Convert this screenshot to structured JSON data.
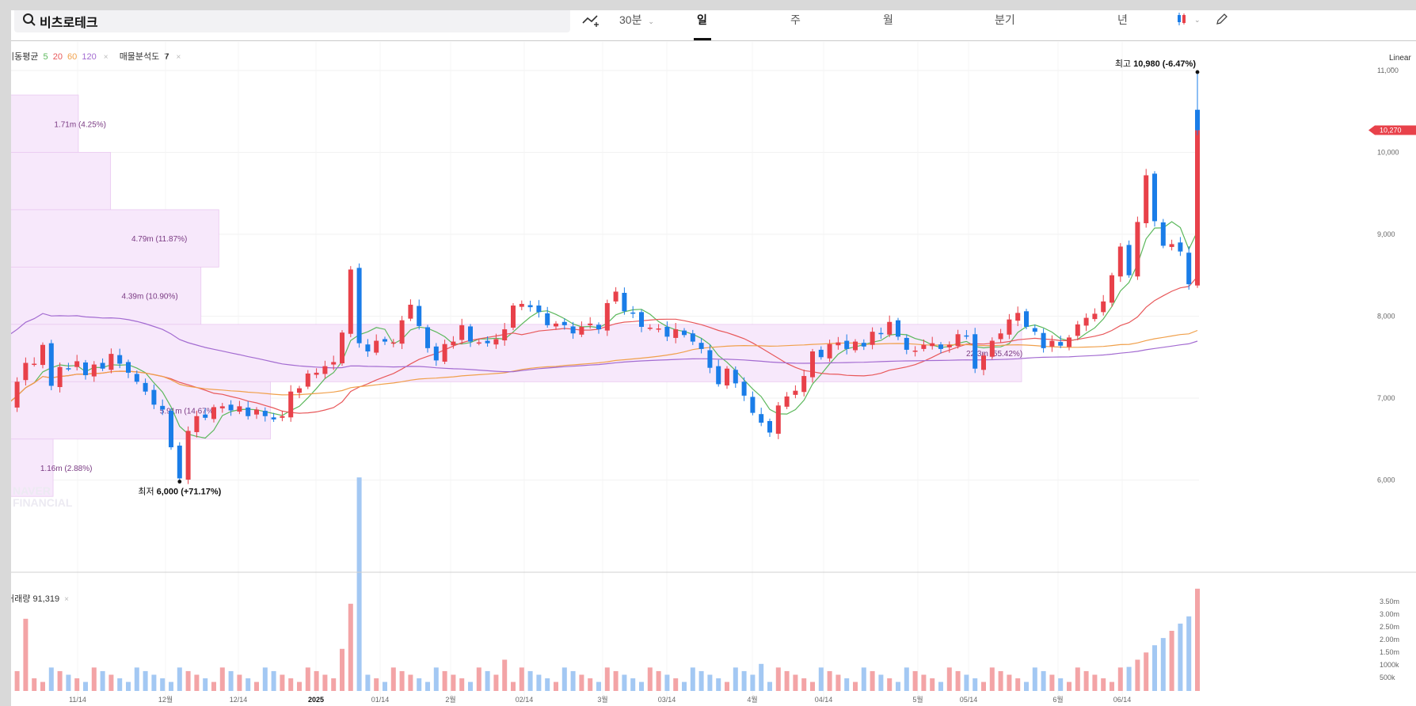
{
  "search": {
    "value": "비츠로테크"
  },
  "toolbar": {
    "drawing_icon": "trend-line-icon",
    "interval": "30분",
    "tabs": [
      "일",
      "주",
      "월",
      "분기",
      "년"
    ],
    "active_tab": "일",
    "chart_style_icon": "candle-icon",
    "edit_icon": "pencil-icon"
  },
  "overlays": {
    "ma_label": "이동평균",
    "ma_periods": [
      "5",
      "20",
      "60",
      "120"
    ],
    "ma_colors": [
      "#5cb85c",
      "#e8585a",
      "#f0a04b",
      "#a36bd1"
    ],
    "volume_profile_label": "매물분석도",
    "volume_profile_value": "7",
    "close_symbol": "×"
  },
  "volume": {
    "label": "거래량",
    "value": "91,319"
  },
  "scale_mode": "Linear",
  "colors": {
    "up": "#e8414a",
    "down": "#1a7de8",
    "up_vol": "#f3a4a6",
    "down_vol": "#a3c8f3",
    "profile": "#f7e8fb"
  },
  "watermark": [
    "NAVER",
    "FINANCIAL"
  ],
  "chart_data": {
    "type": "candlestick",
    "price_axis": {
      "ticks": [
        "11,000",
        "10,000",
        "9,000",
        "8,000",
        "7,000",
        "6,000"
      ],
      "ylim": [
        5900,
        11300
      ]
    },
    "volume_axis": {
      "ticks": [
        "3.50m",
        "3.00m",
        "2.50m",
        "2.00m",
        "1.50m",
        "1000k",
        "500k"
      ]
    },
    "x_ticks": [
      "11/14",
      "12월",
      "12/14",
      "2025",
      "01/14",
      "2월",
      "02/14",
      "3월",
      "03/14",
      "4월",
      "04/14",
      "5월",
      "05/14",
      "6월",
      "06/14"
    ],
    "current_price": {
      "label": "10,270",
      "value": 10270
    },
    "high": {
      "prefix": "최고",
      "value": "10,980",
      "change": "(-6.47%)"
    },
    "low": {
      "prefix": "최저",
      "value": "6,000",
      "change": "(+71.17%)"
    },
    "volume_profile": [
      {
        "label": "1.71m (4.25%)",
        "from": 10000,
        "to": 10700,
        "fraction": 0.0425
      },
      {
        "label": "",
        "from": 9300,
        "to": 10000,
        "fraction": 0.06
      },
      {
        "label": "4.79m (11.87%)",
        "from": 8600,
        "to": 9300,
        "fraction": 0.1187
      },
      {
        "label": "4.39m (10.90%)",
        "from": 7900,
        "to": 8600,
        "fraction": 0.109
      },
      {
        "label": "22.3m (55.42%)",
        "from": 7200,
        "to": 7900,
        "fraction": 0.5542
      },
      {
        "label": "5.91m (14.67%)",
        "from": 6500,
        "to": 7200,
        "fraction": 0.1467
      },
      {
        "label": "1.16m (2.88%)",
        "from": 5800,
        "to": 6500,
        "fraction": 0.0288
      }
    ],
    "closes": [
      6980,
      6900,
      7200,
      7430,
      7420,
      7650,
      7150,
      7380,
      7360,
      7450,
      7280,
      7410,
      7360,
      7540,
      7420,
      7310,
      7200,
      7080,
      6920,
      6860,
      6400,
      6020,
      6600,
      6780,
      6760,
      6890,
      6900,
      6850,
      6900,
      6780,
      6860,
      6780,
      6740,
      6780,
      7080,
      7120,
      7300,
      7310,
      7390,
      7440,
      7800,
      8570,
      7670,
      7570,
      7700,
      7690,
      7680,
      7950,
      8140,
      7880,
      7610,
      7460,
      7660,
      7690,
      7890,
      7690,
      7680,
      7670,
      7720,
      7840,
      8130,
      8150,
      8110,
      8050,
      7890,
      7910,
      7890,
      7790,
      7870,
      7910,
      7840,
      8160,
      8300,
      8060,
      8030,
      7870,
      7860,
      7850,
      7750,
      7840,
      7770,
      7690,
      7600,
      7370,
      7170,
      7360,
      7180,
      7030,
      6820,
      6700,
      6580,
      6910,
      7020,
      7090,
      7270,
      7570,
      7500,
      7660,
      7680,
      7600,
      7690,
      7630,
      7810,
      7790,
      7930,
      7750,
      7590,
      7580,
      7650,
      7670,
      7600,
      7650,
      7780,
      7760,
      7360,
      7520,
      7700,
      7790,
      7960,
      8040,
      7870,
      7810,
      7610,
      7700,
      7640,
      7740,
      7900,
      7980,
      8030,
      8180,
      8500,
      8850,
      8500,
      9150,
      9720,
      9160,
      8860,
      8880,
      8790,
      8390,
      10270
    ]
  }
}
